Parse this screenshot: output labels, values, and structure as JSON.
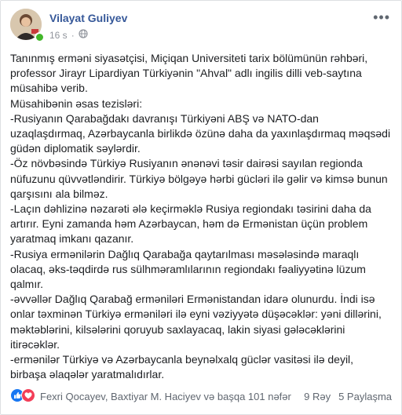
{
  "post": {
    "author": "Vilayat Guliyev",
    "time": "16 s",
    "privacy_icon": "globe-icon",
    "paragraphs": [
      "Tanınmış erməni siyasətçisi, Miçiqan Universiteti tarix bölümünün rəhbəri, professor Jirayr Lipardiyan Türkiyənin \"Ahval\" adlı ingilis dilli veb-saytına müsahibə verib.",
      "Müsahibənin əsas tezisləri:",
      "-Rusiyanın Qarabağdakı davranışı Türkiyəni ABŞ və NATO-dan uzaqlaşdırmaq, Azərbaycanla birlikdə özünə daha da yaxınlaşdırmaq məqsədi güdən diplomatik səylərdir.",
      "-Öz növbəsində Türkiyə Rusiyanın ənənəvi təsir dairəsi sayılan regionda nüfuzunu qüvvətləndirir. Türkiyə bölgəyə hərbi gücləri ilə gəlir və kimsə bunun qarşısını ala bilməz.",
      "-Laçın dəhlizinə nəzarəti ələ keçirməklə Rusiya regiondakı təsirini daha da artırır. Eyni zamanda həm Azərbaycan, həm də Ermənistan üçün problem yaratmaq imkanı qazanır.",
      "-Rusiya ermənilərin Dağlıq Qarabağa qaytarılması məsələsində maraqlı olacaq, əks-təqdirdə rus sülhməramlılarının regiondakı fəaliyyətinə lüzum qalmır.",
      "-əvvəllər Dağlıq Qarabağ erməniləri Ermənistandan idarə olunurdu. İndi isə onlar təxminən Türkiyə erməniləri ilə eyni vəziyyətə düşəcəklər: yəni dillərini, məktəblərini, kilsələrini qoruyub saxlayacaq, lakin siyasi gələcəklərini itirəcəklər.",
      "-ermənilər Türkiyə və Azərbaycanla beynəlxalq güclər vasitəsi ilə deyil, birbaşa əlaqələr yaratmalıdırlar."
    ]
  },
  "footer": {
    "reaction_icons": [
      "like-icon",
      "love-icon"
    ],
    "reactors": "Fexri Qocayev, Baxtiyar M. Haciyev və başqa 101 nəfər",
    "comments": "9 Rəy",
    "shares": "5 Paylaşma"
  },
  "colors": {
    "author_link": "#365899",
    "meta_gray": "#90949c",
    "like_blue": "#1877f2",
    "love_red": "#f33e58",
    "online_green": "#42b72a"
  }
}
